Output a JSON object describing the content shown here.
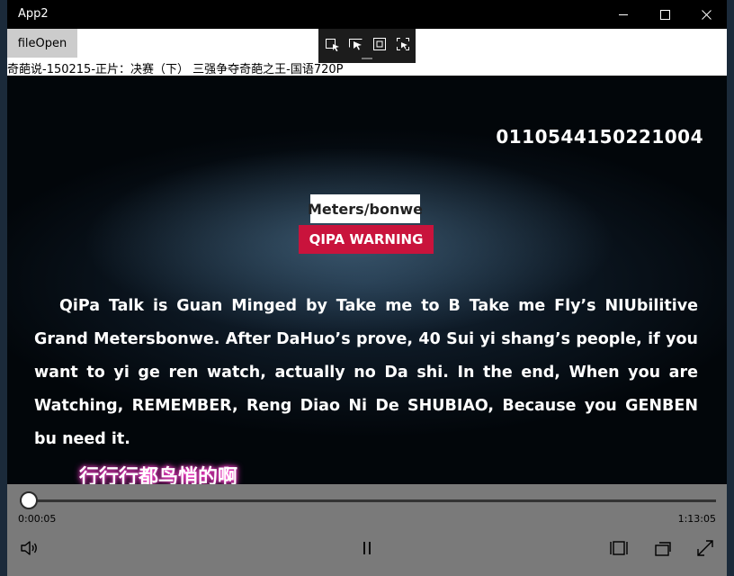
{
  "window": {
    "title": "App2"
  },
  "toolbar": {
    "file_open_label": "fileOpen"
  },
  "media": {
    "filename": "奇葩说-150215-正片：决赛（下） 三强争夺奇葩之王-国语720P"
  },
  "video": {
    "code": "0110544150221004",
    "brand": "Meters/bonwe",
    "warning": "QIPA WARNING",
    "paragraph": "QiPa Talk is Guan Minged by Take me to B Take me Fly’s NIUbilitive Grand Metersbonwe.  After DaHuo’s prove, 40 Sui yi shang’s people, if you want to yi ge ren watch,  actually no Da shi. In the end,  When you are Watching, REMEMBER, Reng Diao Ni De SHUBIAO, Because you GENBEN bu need it.",
    "subtitle": "行行行都鸟悄的啊"
  },
  "player": {
    "elapsed": "0:00:05",
    "duration": "1:13:05",
    "progress_fraction": 0.001
  },
  "icons": {
    "volume": "volume-icon",
    "pause": "pause-icon",
    "aspect": "aspect-ratio-icon",
    "cast": "cast-icon",
    "fullscreen": "fullscreen-icon"
  },
  "colors": {
    "window_bg": "#000000",
    "toolbar_bg": "#ffffff",
    "controls_bg": "#7a7a7a",
    "warning_red": "#c9133c",
    "subtitle_glow": "#ff3fcf"
  }
}
